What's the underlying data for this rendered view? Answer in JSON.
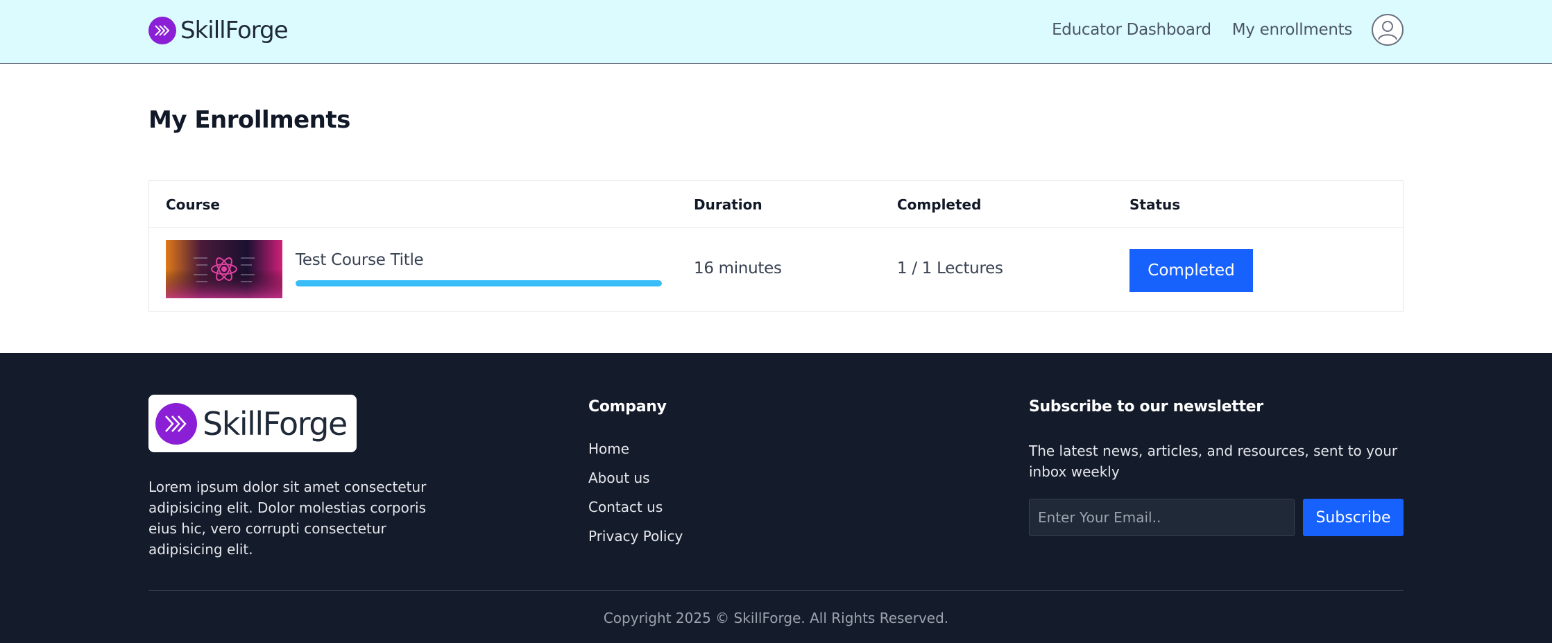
{
  "header": {
    "brand": "SkillForge",
    "nav": [
      "Educator Dashboard",
      "My enrollments"
    ]
  },
  "page": {
    "title": "My Enrollments"
  },
  "table": {
    "columns": [
      "Course",
      "Duration",
      "Completed",
      "Status"
    ],
    "rows": [
      {
        "course_title": "Test Course Title",
        "progress_percent": 100,
        "duration": "16 minutes",
        "completed": "1 / 1 Lectures",
        "status": "Completed"
      }
    ]
  },
  "footer": {
    "brand": "SkillForge",
    "about": "Lorem ipsum dolor sit amet consectetur adipisicing elit. Dolor molestias corporis eius hic, vero corrupti consectetur adipisicing elit.",
    "company_title": "Company",
    "company_links": [
      "Home",
      "About us",
      "Contact us",
      "Privacy Policy"
    ],
    "newsletter_title": "Subscribe to our newsletter",
    "newsletter_text": "The latest news, articles, and resources, sent to your inbox weekly",
    "email_placeholder": "Enter Your Email..",
    "subscribe_label": "Subscribe",
    "copyright": "Copyright 2025 © SkillForge. All Rights Reserved."
  },
  "colors": {
    "header_bg": "#dcfbff",
    "brand_purple": "#8a1fd6",
    "accent_blue": "#1761fd",
    "progress_blue": "#38bdf8",
    "footer_bg": "#141b2b"
  },
  "icons": [
    "double-chevron-logo-icon",
    "user-avatar-icon",
    "react-logo-icon"
  ]
}
